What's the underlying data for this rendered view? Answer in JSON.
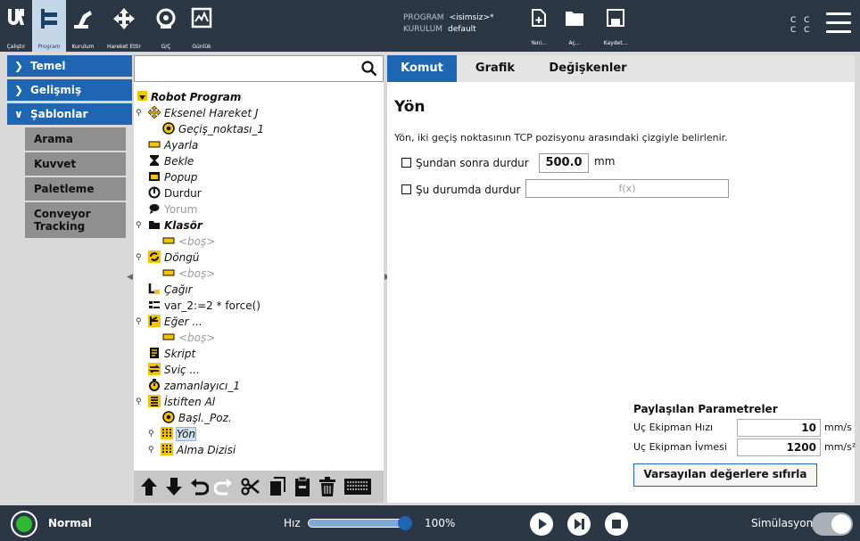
{
  "header": {
    "nav": [
      {
        "label": "Çalıştır",
        "icon": "ur-logo-icon"
      },
      {
        "label": "Program",
        "icon": "program-tree-icon"
      },
      {
        "label": "Kurulum",
        "icon": "robot-arm-icon"
      },
      {
        "label": "Hareket Ettir",
        "icon": "move-arrows-icon"
      },
      {
        "label": "G/Ç",
        "icon": "io-icon"
      },
      {
        "label": "Günlük",
        "icon": "log-icon"
      }
    ],
    "program_label": "PROGRAM",
    "program_value": "<isimsiz>*",
    "installation_label": "KURULUM",
    "installation_value": "default",
    "file_buttons": [
      {
        "label": "Yeni...",
        "icon": "new-file-icon"
      },
      {
        "label": "Aç...",
        "icon": "open-folder-icon"
      },
      {
        "label": "Kaydet...",
        "icon": "save-icon"
      }
    ],
    "cc_line1": "C C",
    "cc_line2": "C C",
    "accent": "#2b3745"
  },
  "sidebar": {
    "items": [
      {
        "label": "Temel",
        "expanded": false
      },
      {
        "label": "Gelişmiş",
        "expanded": false
      },
      {
        "label": "Şablonlar",
        "expanded": true
      }
    ],
    "subitems": [
      "Arama",
      "Kuvvet",
      "Paletleme",
      "Conveyor Tracking"
    ],
    "accent": "#1f66b2"
  },
  "tree": {
    "search_placeholder": "",
    "nodes": [
      {
        "label": "Robot Program",
        "icon": "expand-triangle-icon"
      },
      {
        "label": "Eksenel Hareket J",
        "icon": "move-icon"
      },
      {
        "label": "Geçiş_noktası_1",
        "icon": "waypoint-icon"
      },
      {
        "label": "Ayarla",
        "icon": "set-icon"
      },
      {
        "label": "Bekle",
        "icon": "hourglass-icon"
      },
      {
        "label": "Popup",
        "icon": "popup-icon"
      },
      {
        "label": "Durdur",
        "icon": "halt-icon"
      },
      {
        "label": "Yorum",
        "icon": "comment-icon"
      },
      {
        "label": "Klasör",
        "icon": "folder-icon"
      },
      {
        "label": "<boş>",
        "icon": "empty-icon"
      },
      {
        "label": "Döngü",
        "icon": "loop-icon"
      },
      {
        "label": "<boş>",
        "icon": "empty-icon"
      },
      {
        "label": "Çağır",
        "icon": "call-icon"
      },
      {
        "label": "var_2:=2 * force()",
        "icon": "assignment-icon"
      },
      {
        "label": "Eğer ...",
        "icon": "if-icon"
      },
      {
        "label": "<boş>",
        "icon": "empty-icon"
      },
      {
        "label": "Skript",
        "icon": "script-icon"
      },
      {
        "label": "Sviç ...",
        "icon": "switch-icon"
      },
      {
        "label": "zamanlayıcı_1",
        "icon": "timer-icon"
      },
      {
        "label": "İstiften Al",
        "icon": "destack-icon"
      },
      {
        "label": "Başl._Poz.",
        "icon": "waypoint-icon"
      },
      {
        "label": "Yön",
        "icon": "direction-icon"
      },
      {
        "label": "Alma Dizisi",
        "icon": "sequence-icon"
      }
    ],
    "toolbar": [
      "move-up-icon",
      "move-down-icon",
      "undo-icon",
      "redo-icon",
      "cut-icon",
      "copy-icon",
      "paste-icon",
      "delete-icon",
      "suppress-icon"
    ]
  },
  "main": {
    "tabs": [
      "Komut",
      "Grafik",
      "Değişkenler"
    ],
    "title": "Yön",
    "description": "Yön, iki geçiş noktasının TCP pozisyonu arasındaki çizgiyle belirlenir.",
    "stop_after_label": "Şundan sonra durdur",
    "stop_after_value": "500.0",
    "stop_after_unit": "mm",
    "stop_when_label": "Şu durumda durdur",
    "stop_when_expr": "f(x)",
    "shared": {
      "title": "Paylaşılan Parametreler",
      "speed_label": "Uç Ekipman Hızı",
      "speed_value": "10",
      "speed_unit": "mm/s",
      "accel_label": "Uç Ekipman İvmesi",
      "accel_value": "1200",
      "accel_unit": "mm/s²",
      "reset_label": "Varsayılan değerlere sıfırla"
    }
  },
  "footer": {
    "status": "Normal",
    "status_color": "#30b832",
    "speed_label": "Hız",
    "speed_value": "100%",
    "speed_fraction": 1.0,
    "sim_label": "Simülasyon",
    "sim_on": false
  }
}
